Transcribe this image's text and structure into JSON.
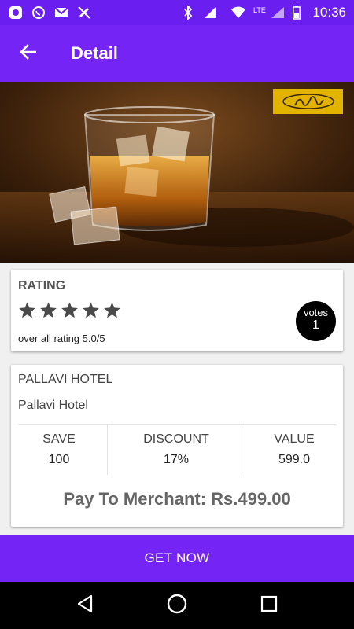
{
  "status_bar": {
    "time": "10:36",
    "network_label": "LTE",
    "signal_label": "4G",
    "left_icons": [
      "app-notification-icon",
      "whatsapp-icon",
      "gmail-icon",
      "no-call-icon"
    ],
    "right_icons": [
      "bluetooth-icon",
      "signal-4g-icon",
      "wifi-icon",
      "lte-signal-icon",
      "battery-icon"
    ]
  },
  "app_bar": {
    "title": "Detail",
    "back_icon": "arrow-left-icon"
  },
  "hero": {
    "image": "whisky-glass-photo",
    "logo": "hm-logo"
  },
  "rating": {
    "title": "RATING",
    "stars": 5,
    "overall_text": "over all rating 5.0/5",
    "votes_label": "votes",
    "votes_count": "1"
  },
  "deal": {
    "merchant_title": "PALLAVI HOTEL",
    "merchant_name": "Pallavi Hotel",
    "stats": [
      {
        "label": "SAVE",
        "value": "100"
      },
      {
        "label": "DISCOUNT",
        "value": "17%"
      },
      {
        "label": "VALUE",
        "value": "599.0"
      }
    ],
    "pay_text": "Pay To Merchant: Rs.499.00"
  },
  "cta": {
    "label": "GET NOW"
  },
  "nav": {
    "icons": [
      "back-triangle-icon",
      "home-circle-icon",
      "recents-square-icon"
    ]
  },
  "colors": {
    "primary": "#7424f5",
    "status_bar": "#6a1ff0",
    "logo_badge": "#e2b400"
  }
}
